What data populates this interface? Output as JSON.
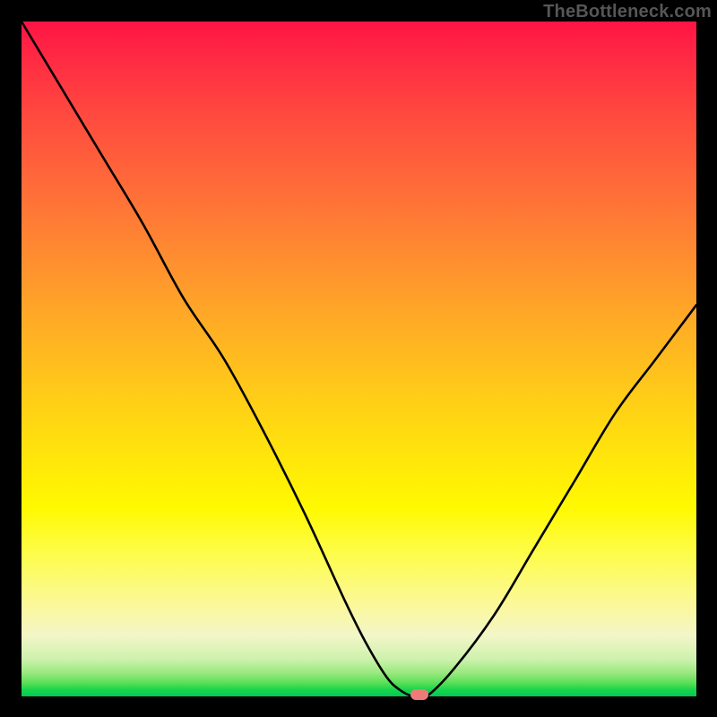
{
  "watermark": "TheBottleneck.com",
  "colors": {
    "frame": "#000000",
    "gradient_top": "#ff1444",
    "gradient_bottom": "#00c956",
    "curve": "#000000",
    "marker": "#ee7b77"
  },
  "chart_data": {
    "type": "line",
    "title": "",
    "xlabel": "",
    "ylabel": "",
    "xlim": [
      0,
      100
    ],
    "ylim": [
      0,
      100
    ],
    "grid": false,
    "legend": false,
    "series": [
      {
        "name": "bottleneck-curve",
        "x": [
          0,
          6,
          12,
          18,
          24,
          30,
          36,
          42,
          48,
          51,
          54,
          56,
          58,
          60,
          64,
          70,
          76,
          82,
          88,
          94,
          100
        ],
        "y": [
          100,
          90,
          80,
          70,
          59,
          50,
          39,
          27,
          14,
          8,
          3,
          1,
          0,
          0,
          4,
          12,
          22,
          32,
          42,
          50,
          58
        ]
      }
    ],
    "marker": {
      "x": 59,
      "y": 0
    }
  }
}
